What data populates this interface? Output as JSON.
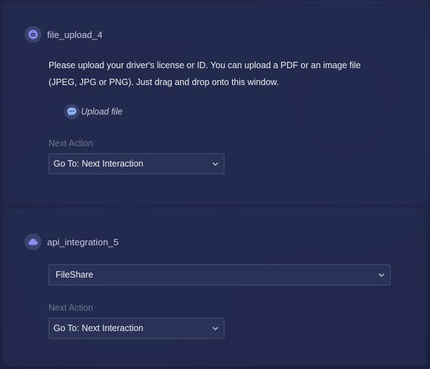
{
  "nodes": [
    {
      "title": "file_upload_4",
      "icon": "robot-icon",
      "prompt": "Please upload your driver's license or ID. You can upload a PDF or an image file (JPEG, JPG or PNG). Just drag and drop onto this window.",
      "upload_label": "Upload file",
      "upload_icon": "chat-bubble-icon",
      "next_action_label": "Next Action",
      "next_action_value": "Go To: Next Interaction"
    },
    {
      "title": "api_integration_5",
      "icon": "cloud-icon",
      "service_value": "FileShare",
      "next_action_label": "Next Action",
      "next_action_value": "Go To: Next Interaction"
    }
  ],
  "colors": {
    "background": "#1d2342",
    "card": "#232a4e",
    "accent": "#8f8ff0",
    "select_bg": "#2b3258"
  }
}
